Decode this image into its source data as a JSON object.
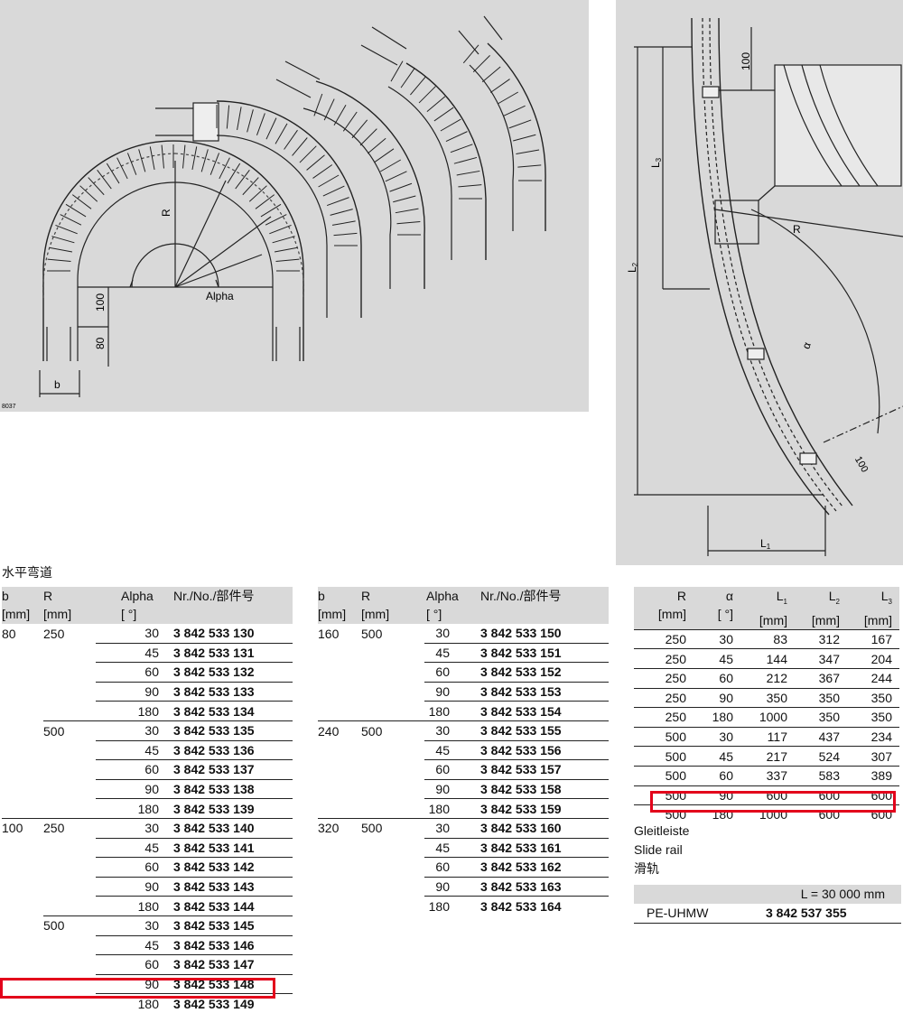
{
  "drawing_left": {
    "label_R": "R",
    "label_alpha": "Alpha",
    "dim_100": "100",
    "dim_80": "80",
    "dim_b": "b",
    "figure_id": "8037"
  },
  "drawing_right": {
    "dim_100_top": "100",
    "label_L3": "L",
    "label_L3_sub": "3",
    "label_L2": "L",
    "label_L2_sub": "2",
    "label_L1": "L",
    "label_L1_sub": "1",
    "label_R": "R",
    "label_alpha": "α",
    "dim_100_bottom": "100"
  },
  "heading": "水平弯道",
  "table_headers": {
    "b": "b",
    "b_unit": "[mm]",
    "R": "R",
    "R_unit": "[mm]",
    "alpha": "Alpha",
    "alpha_unit": "[ °]",
    "nr": "Nr./No./部件号"
  },
  "table1": [
    {
      "b": "80",
      "R": "250",
      "alpha": "30",
      "nr": "3 842 533 130"
    },
    {
      "b": "",
      "R": "",
      "alpha": "45",
      "nr": "3 842 533 131"
    },
    {
      "b": "",
      "R": "",
      "alpha": "60",
      "nr": "3 842 533 132"
    },
    {
      "b": "",
      "R": "",
      "alpha": "90",
      "nr": "3 842 533 133"
    },
    {
      "b": "",
      "R": "",
      "alpha": "180",
      "nr": "3 842 533 134"
    },
    {
      "b": "",
      "R": "500",
      "alpha": "30",
      "nr": "3 842 533 135"
    },
    {
      "b": "",
      "R": "",
      "alpha": "45",
      "nr": "3 842 533 136"
    },
    {
      "b": "",
      "R": "",
      "alpha": "60",
      "nr": "3 842 533 137"
    },
    {
      "b": "",
      "R": "",
      "alpha": "90",
      "nr": "3 842 533 138"
    },
    {
      "b": "",
      "R": "",
      "alpha": "180",
      "nr": "3 842 533 139"
    },
    {
      "b": "100",
      "R": "250",
      "alpha": "30",
      "nr": "3 842 533 140"
    },
    {
      "b": "",
      "R": "",
      "alpha": "45",
      "nr": "3 842 533 141"
    },
    {
      "b": "",
      "R": "",
      "alpha": "60",
      "nr": "3 842 533 142"
    },
    {
      "b": "",
      "R": "",
      "alpha": "90",
      "nr": "3 842 533 143"
    },
    {
      "b": "",
      "R": "",
      "alpha": "180",
      "nr": "3 842 533 144"
    },
    {
      "b": "",
      "R": "500",
      "alpha": "30",
      "nr": "3 842 533 145"
    },
    {
      "b": "",
      "R": "",
      "alpha": "45",
      "nr": "3 842 533 146"
    },
    {
      "b": "",
      "R": "",
      "alpha": "60",
      "nr": "3 842 533 147"
    },
    {
      "b": "",
      "R": "",
      "alpha": "90",
      "nr": "3 842 533 148"
    },
    {
      "b": "",
      "R": "",
      "alpha": "180",
      "nr": "3 842 533 149"
    }
  ],
  "table2": [
    {
      "b": "160",
      "R": "500",
      "alpha": "30",
      "nr": "3 842 533 150"
    },
    {
      "b": "",
      "R": "",
      "alpha": "45",
      "nr": "3 842 533 151"
    },
    {
      "b": "",
      "R": "",
      "alpha": "60",
      "nr": "3 842 533 152"
    },
    {
      "b": "",
      "R": "",
      "alpha": "90",
      "nr": "3 842 533 153"
    },
    {
      "b": "",
      "R": "",
      "alpha": "180",
      "nr": "3 842 533 154"
    },
    {
      "b": "240",
      "R": "500",
      "alpha": "30",
      "nr": "3 842 533 155"
    },
    {
      "b": "",
      "R": "",
      "alpha": "45",
      "nr": "3 842 533 156"
    },
    {
      "b": "",
      "R": "",
      "alpha": "60",
      "nr": "3 842 533 157"
    },
    {
      "b": "",
      "R": "",
      "alpha": "90",
      "nr": "3 842 533 158"
    },
    {
      "b": "",
      "R": "",
      "alpha": "180",
      "nr": "3 842 533 159"
    },
    {
      "b": "320",
      "R": "500",
      "alpha": "30",
      "nr": "3 842 533 160"
    },
    {
      "b": "",
      "R": "",
      "alpha": "45",
      "nr": "3 842 533 161"
    },
    {
      "b": "",
      "R": "",
      "alpha": "60",
      "nr": "3 842 533 162"
    },
    {
      "b": "",
      "R": "",
      "alpha": "90",
      "nr": "3 842 533 163"
    },
    {
      "b": "",
      "R": "",
      "alpha": "180",
      "nr": "3 842 533 164"
    }
  ],
  "dim_headers": {
    "R": "R",
    "alpha": "α",
    "L1": "L",
    "L1_sub": "1",
    "L2": "L",
    "L2_sub": "2",
    "L3": "L",
    "L3_sub": "3",
    "unit_mm": "[mm]",
    "unit_deg": "[ °]"
  },
  "dim_table": [
    {
      "R": "250",
      "alpha": "30",
      "L1": "83",
      "L2": "312",
      "L3": "167"
    },
    {
      "R": "250",
      "alpha": "45",
      "L1": "144",
      "L2": "347",
      "L3": "204"
    },
    {
      "R": "250",
      "alpha": "60",
      "L1": "212",
      "L2": "367",
      "L3": "244"
    },
    {
      "R": "250",
      "alpha": "90",
      "L1": "350",
      "L2": "350",
      "L3": "350"
    },
    {
      "R": "250",
      "alpha": "180",
      "L1": "1000",
      "L2": "350",
      "L3": "350"
    },
    {
      "R": "500",
      "alpha": "30",
      "L1": "117",
      "L2": "437",
      "L3": "234"
    },
    {
      "R": "500",
      "alpha": "45",
      "L1": "217",
      "L2": "524",
      "L3": "307"
    },
    {
      "R": "500",
      "alpha": "60",
      "L1": "337",
      "L2": "583",
      "L3": "389"
    },
    {
      "R": "500",
      "alpha": "90",
      "L1": "600",
      "L2": "600",
      "L3": "600"
    },
    {
      "R": "500",
      "alpha": "180",
      "L1": "1000",
      "L2": "600",
      "L3": "600"
    }
  ],
  "slide_rail": {
    "title_de": "Gleitleiste",
    "title_en": "Slide rail",
    "title_cn": "滑轨",
    "length": "L = 30 000 mm",
    "material": "PE-UHMW",
    "nr": "3 842 537 355"
  },
  "colors": {
    "panel": "#d9d9d9",
    "highlight": "#e3001b"
  }
}
